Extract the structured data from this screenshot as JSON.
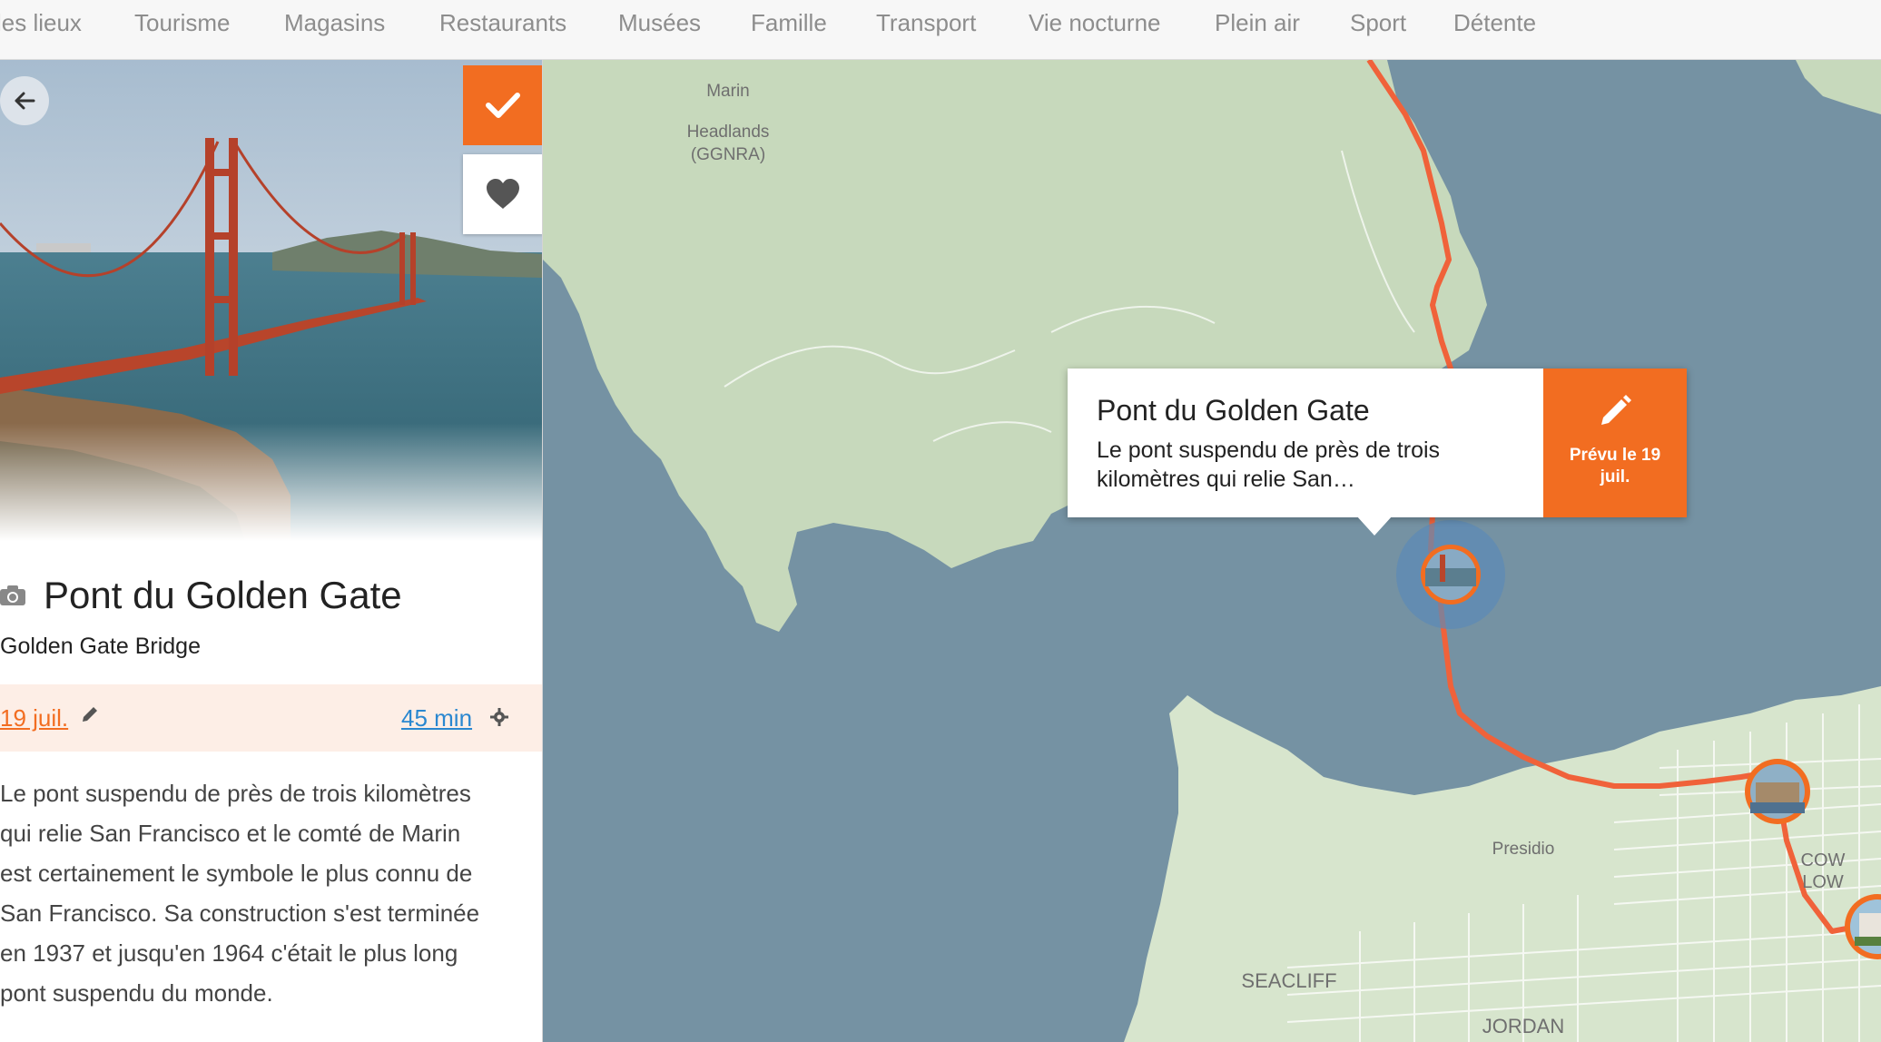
{
  "categories": [
    "les lieux",
    "Tourisme",
    "Magasins",
    "Restaurants",
    "Musées",
    "Famille",
    "Transport",
    "Vie nocturne",
    "Plein air",
    "Sport",
    "Détente"
  ],
  "detail": {
    "title": "Pont du Golden Gate",
    "subtitle": "Golden Gate Bridge",
    "date": "19 juil.",
    "duration": "45 min",
    "description": [
      "Le pont suspendu de près de trois kilomètres",
      "qui relie San Francisco et le comté de Marin",
      "est certainement le symbole le plus connu de",
      "San Francisco. Sa construction s'est terminée",
      "en 1937 et jusqu'en 1964 c'était le plus long",
      "pont suspendu du monde."
    ]
  },
  "popup": {
    "title": "Pont du Golden Gate",
    "description": [
      "Le pont suspendu de près de trois",
      "kilomètres qui relie San…"
    ],
    "plan_label_line1": "Prévu le 19",
    "plan_label_line2": "juil."
  },
  "map": {
    "labels": {
      "marin_top": "Marin",
      "headlands": "Headlands",
      "ggnra": "(GGNRA)",
      "presidio": "Presidio",
      "seacliff": "SEACLIFF",
      "cow": "COW",
      "hollow": "LOW",
      "jordan": "JORDAN"
    }
  },
  "icons": {
    "back": "arrow-left-icon",
    "check": "check-icon",
    "heart": "heart-icon",
    "camera": "camera-icon",
    "pencil": "pencil-icon",
    "gear": "gear-icon"
  },
  "colors": {
    "accent": "#f26d21",
    "link_blue": "#2a87d0",
    "water": "#7592a3",
    "land": "#c7d9bc",
    "route": "#f0623a"
  }
}
